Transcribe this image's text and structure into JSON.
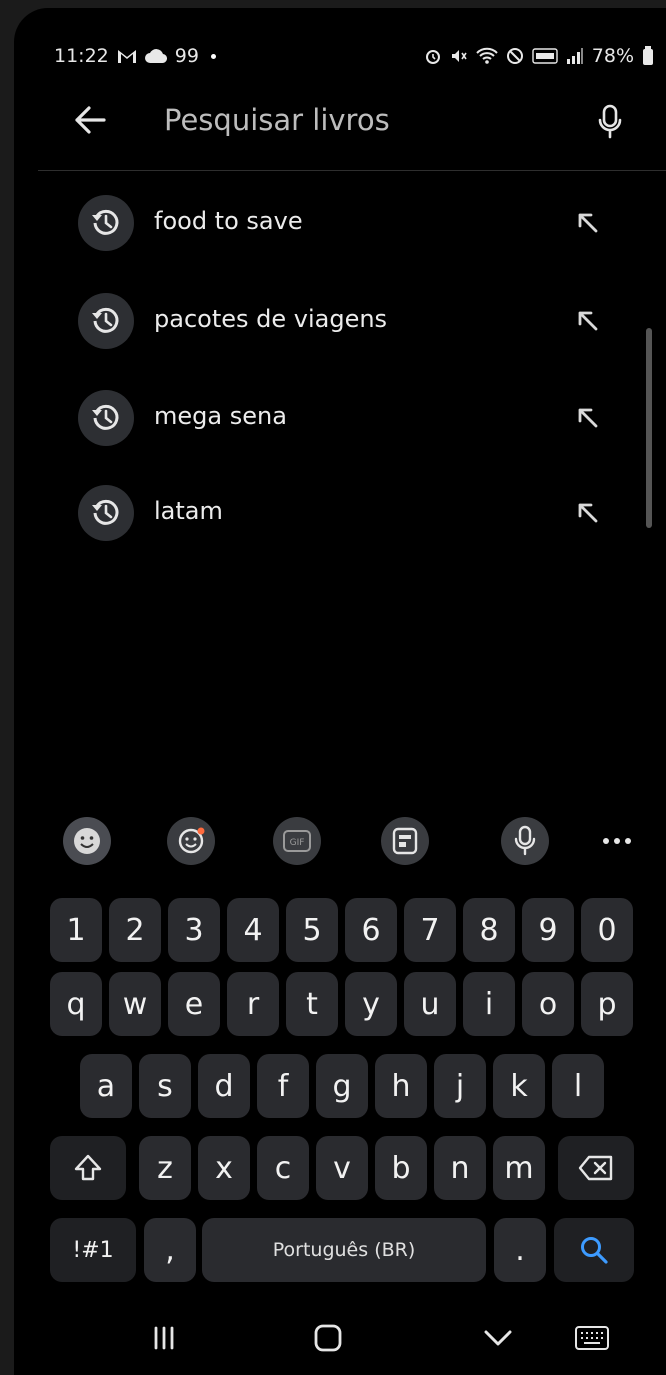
{
  "status_bar": {
    "time": "11:22",
    "left_icons": [
      "gmail-icon",
      "cloud-icon"
    ],
    "left_count": "99",
    "battery": "78%",
    "right_icons": [
      "alarm-icon",
      "mute-icon",
      "wifi-icon",
      "do-not-disturb-icon",
      "volte-icon",
      "signal-icon",
      "battery-icon"
    ]
  },
  "search": {
    "placeholder": "Pesquisar livros"
  },
  "suggestions": [
    {
      "label": "food to save"
    },
    {
      "label": "pacotes de viagens"
    },
    {
      "label": "mega sena"
    },
    {
      "label": "latam"
    }
  ],
  "keyboard": {
    "toolbar": [
      "emoji-toggle-icon",
      "sticker-icon",
      "gif-icon",
      "clipboard-icon",
      "voice-input-icon",
      "more-options-icon"
    ],
    "row_numbers": [
      "1",
      "2",
      "3",
      "4",
      "5",
      "6",
      "7",
      "8",
      "9",
      "0"
    ],
    "row_1": [
      "q",
      "w",
      "e",
      "r",
      "t",
      "y",
      "u",
      "i",
      "o",
      "p"
    ],
    "row_2": [
      "a",
      "s",
      "d",
      "f",
      "g",
      "h",
      "j",
      "k",
      "l"
    ],
    "row_3": [
      "z",
      "x",
      "c",
      "v",
      "b",
      "n",
      "m"
    ],
    "symbols_label": "!#1",
    "comma": ",",
    "space_label": "Português (BR)",
    "period": ".",
    "accent_color": "#3d9bff"
  },
  "navbar": {
    "icons": [
      "recents-icon",
      "home-icon",
      "back-down-icon",
      "keyboard-switch-icon"
    ]
  }
}
